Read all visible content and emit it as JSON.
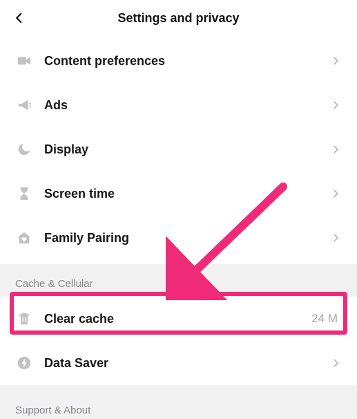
{
  "header": {
    "title": "Settings and privacy"
  },
  "group1": {
    "items": [
      {
        "id": "content-preferences",
        "label": "Content preferences",
        "icon": "video"
      },
      {
        "id": "ads",
        "label": "Ads",
        "icon": "megaphone"
      },
      {
        "id": "display",
        "label": "Display",
        "icon": "moon"
      },
      {
        "id": "screen-time",
        "label": "Screen time",
        "icon": "hourglass"
      },
      {
        "id": "family-pairing",
        "label": "Family Pairing",
        "icon": "house-heart"
      }
    ]
  },
  "section_cache_title": "Cache & Cellular",
  "group2": {
    "items": [
      {
        "id": "clear-cache",
        "label": "Clear cache",
        "icon": "trash",
        "value": "24 M"
      },
      {
        "id": "data-saver",
        "label": "Data Saver",
        "icon": "bolt-circle"
      }
    ]
  },
  "section_support_title": "Support & About",
  "annotations": {
    "highlight_target": "clear-cache",
    "arrow_color": "#ef2a79"
  }
}
